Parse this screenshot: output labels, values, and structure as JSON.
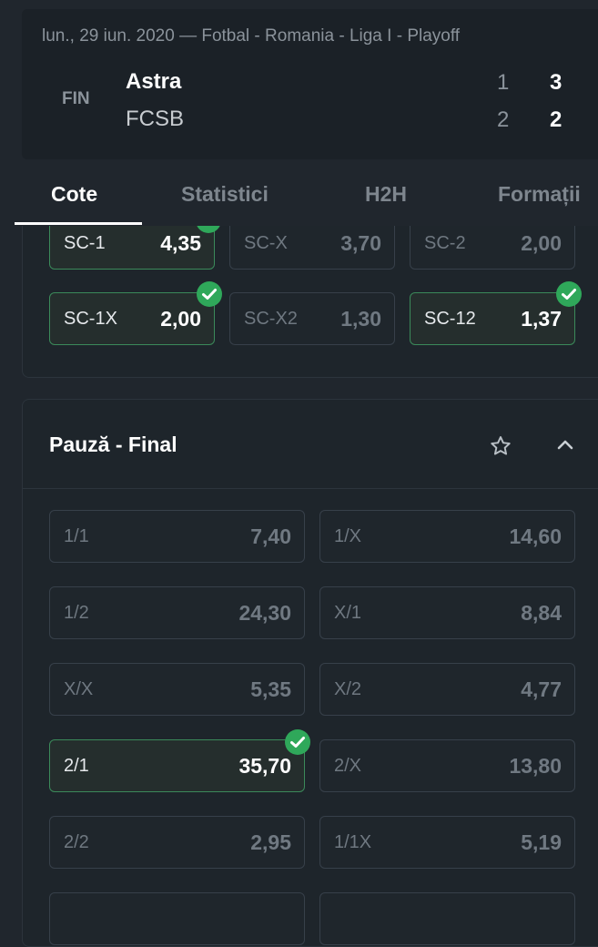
{
  "match": {
    "meta": "lun., 29 iun. 2020 — Fotbal - Romania - Liga I - Playoff",
    "status": "FIN",
    "home": {
      "name": "Astra",
      "ht": "1",
      "ft": "3"
    },
    "away": {
      "name": "FCSB",
      "ht": "2",
      "ft": "2"
    }
  },
  "tabs": [
    "Cote",
    "Statistici",
    "H2H",
    "Formații"
  ],
  "active_tab": "Cote",
  "market1": {
    "odds": [
      {
        "label": "SC-1",
        "value": "4,35",
        "selected": true
      },
      {
        "label": "SC-X",
        "value": "3,70",
        "selected": false
      },
      {
        "label": "SC-2",
        "value": "2,00",
        "selected": false
      },
      {
        "label": "SC-1X",
        "value": "2,00",
        "selected": true
      },
      {
        "label": "SC-X2",
        "value": "1,30",
        "selected": false
      },
      {
        "label": "SC-12",
        "value": "1,37",
        "selected": true
      }
    ]
  },
  "market2": {
    "title": "Pauză - Final",
    "odds": [
      {
        "label": "1/1",
        "value": "7,40",
        "selected": false
      },
      {
        "label": "1/X",
        "value": "14,60",
        "selected": false
      },
      {
        "label": "1/2",
        "value": "24,30",
        "selected": false
      },
      {
        "label": "X/1",
        "value": "8,84",
        "selected": false
      },
      {
        "label": "X/X",
        "value": "5,35",
        "selected": false
      },
      {
        "label": "X/2",
        "value": "4,77",
        "selected": false
      },
      {
        "label": "2/1",
        "value": "35,70",
        "selected": true
      },
      {
        "label": "2/X",
        "value": "13,80",
        "selected": false
      },
      {
        "label": "2/2",
        "value": "2,95",
        "selected": false
      },
      {
        "label": "1/1X",
        "value": "5,19",
        "selected": false
      }
    ]
  },
  "colors": {
    "accent": "#2fa85a",
    "background": "#20262d",
    "panel": "#1e252b"
  }
}
